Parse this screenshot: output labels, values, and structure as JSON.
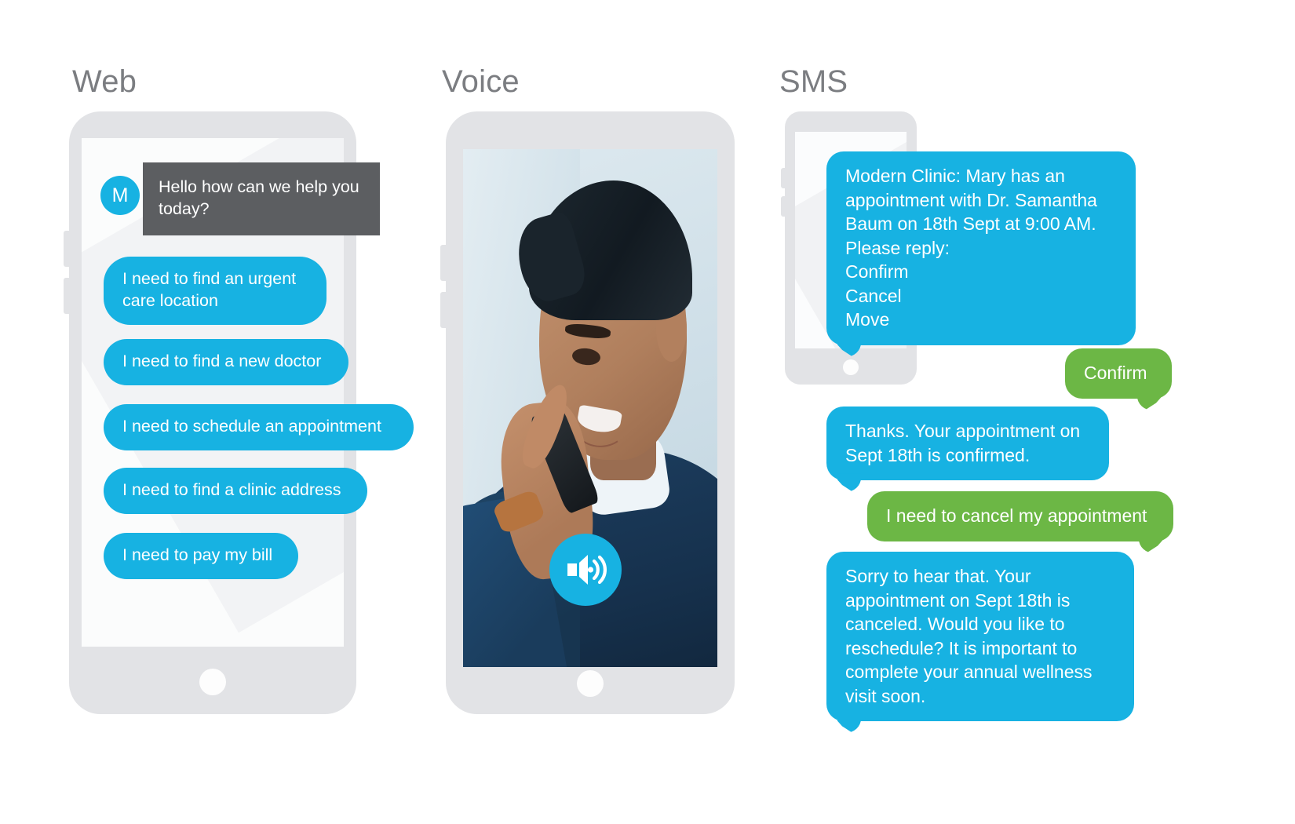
{
  "sections": {
    "web": {
      "title": "Web"
    },
    "voice": {
      "title": "Voice"
    },
    "sms": {
      "title": "SMS"
    }
  },
  "web_chat": {
    "avatar_initial": "M",
    "agent_message": "Hello how can we help you today?",
    "options": [
      "I need to find an urgent care location",
      "I need to find a new doctor",
      "I need to schedule an appointment",
      "I need to find a clinic address",
      "I need to pay my bill"
    ]
  },
  "voice_panel": {
    "speaker_icon": "speaker-volume-icon",
    "photo_alt": "man smiling while talking on a mobile phone"
  },
  "sms_chat": {
    "messages": [
      {
        "sender": "clinic",
        "color": "#17b2e2",
        "text": "Modern Clinic: Mary has an appointment with Dr. Samantha Baum on 18th Sept at 9:00 AM.\nPlease reply:\nConfirm\nCancel\nMove"
      },
      {
        "sender": "user",
        "color": "#6cb745",
        "text": "Confirm"
      },
      {
        "sender": "clinic",
        "color": "#17b2e2",
        "text": "Thanks. Your appointment on Sept 18th is confirmed."
      },
      {
        "sender": "user",
        "color": "#6cb745",
        "text": "I need to cancel my appointment"
      },
      {
        "sender": "clinic",
        "color": "#17b2e2",
        "text": "Sorry to hear that. Your appointment on Sept 18th is canceled. Would you like to reschedule? It is important to complete your annual wellness visit soon."
      }
    ]
  },
  "colors": {
    "accent_cyan": "#17b2e2",
    "accent_green": "#6cb745",
    "agent_gray": "#5c5e61",
    "device_gray": "#e2e3e6",
    "heading_gray": "#7b7d81",
    "page_background": "#ffffff"
  }
}
